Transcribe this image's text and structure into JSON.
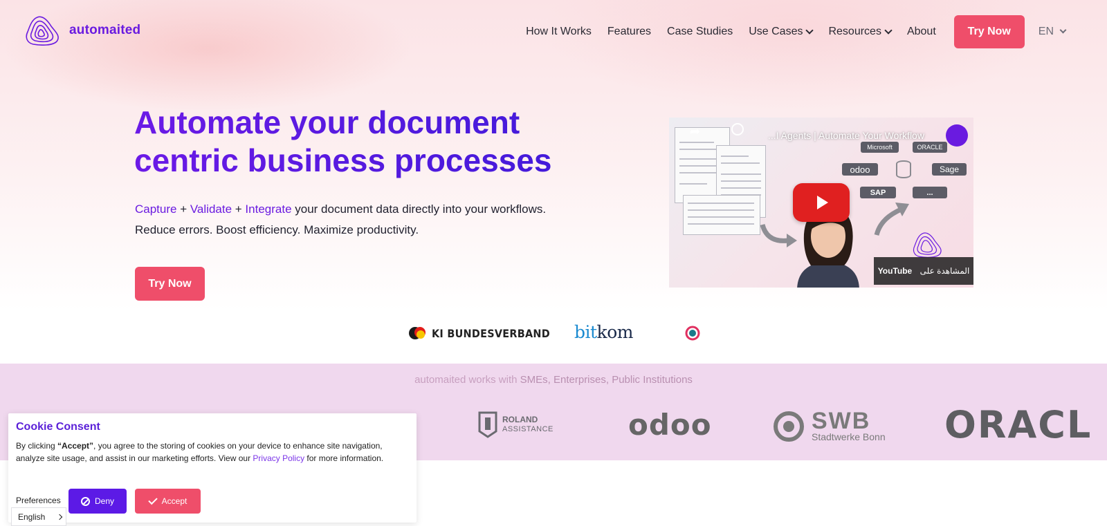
{
  "brand": {
    "name": "automaited",
    "color": "#6a1be0",
    "cta_color": "#ef4e6a"
  },
  "nav": {
    "items": [
      {
        "label": "How It Works"
      },
      {
        "label": "Features"
      },
      {
        "label": "Case Studies"
      },
      {
        "label": "Use Cases",
        "dropdown": true
      },
      {
        "label": "Resources",
        "dropdown": true
      },
      {
        "label": "About"
      }
    ],
    "cta_label": "Try Now",
    "language": "EN"
  },
  "hero": {
    "title": "Automate your document centric business processes",
    "sub_capture": "Capture",
    "sub_plus1": " + ",
    "sub_validate": "Validate",
    "sub_plus2": " + ",
    "sub_integrate": "Integrate",
    "sub_rest": " your document data directly into your workflows.",
    "sub_line2": "Reduce errors. Boost efficiency. Maximize productivity.",
    "cta_label": "Try Now"
  },
  "video": {
    "title": "...I Agents | Automate Your Workflow",
    "tags": [
      "Microsoft",
      "ORACLE",
      "odoo",
      "Sage",
      "SAP",
      "..."
    ],
    "youtube_label": "YouTube",
    "watch_on_label": "المشاهدة على"
  },
  "partners": {
    "ki": "KI BUNDESVERBAND",
    "bitkom_bit": "bit",
    "bitkom_kom": "kom"
  },
  "clients": {
    "intro_prefix": "automaited works with ",
    "intro_bold": "SMEs, Enterprises, Public Institutions",
    "roland_line1": "ROLAND",
    "roland_line2": "ASSISTANCE",
    "odoo": "odoo",
    "swb_big": "SWB",
    "swb_small": "Stadtwerke Bonn",
    "oracle": "ORACL"
  },
  "cookie": {
    "title": "Cookie Consent",
    "text_pre": "By clicking ",
    "text_accept": "“Accept”",
    "text_mid": ", you agree to the storing of cookies on your device to enhance site navigation, analyze site usage, and assist in our marketing efforts. View our ",
    "privacy_link": "Privacy Policy",
    "text_post": " for more information.",
    "preferences_label": "Preferences",
    "deny_label": "Deny",
    "accept_label": "Accept"
  },
  "language_picker": {
    "label": "English"
  }
}
